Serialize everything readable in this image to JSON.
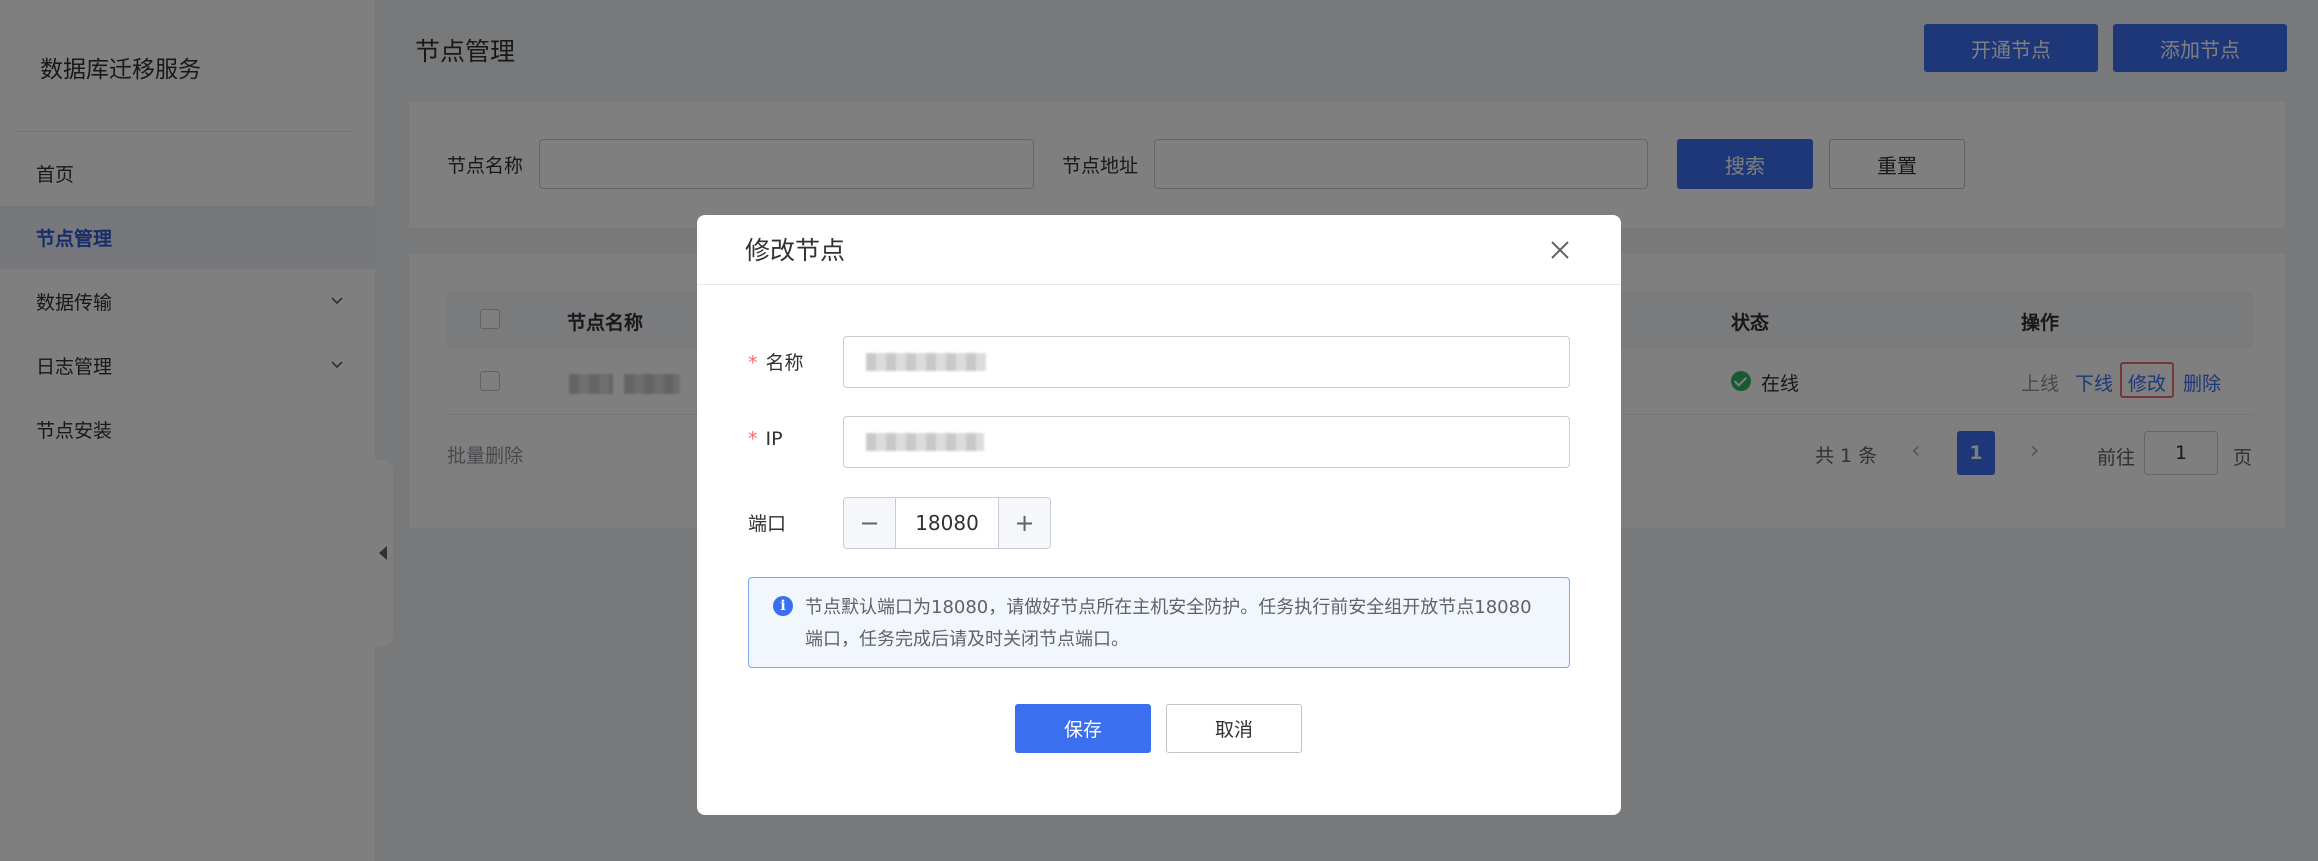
{
  "sidebar": {
    "brand": "数据库迁移服务",
    "items": [
      {
        "label": "首页"
      },
      {
        "label": "节点管理"
      },
      {
        "label": "数据传输"
      },
      {
        "label": "日志管理"
      },
      {
        "label": "节点安装"
      }
    ]
  },
  "header": {
    "title": "节点管理",
    "open_node_label": "开通节点",
    "add_node_label": "添加节点"
  },
  "filter": {
    "name_label": "节点名称",
    "address_label": "节点地址",
    "search_label": "搜索",
    "reset_label": "重置"
  },
  "table": {
    "columns": {
      "name": "节点名称",
      "status": "状态",
      "actions": "操作"
    },
    "rows": [
      {
        "status": "在线",
        "actions": [
          "上线",
          "下线",
          "修改",
          "删除"
        ]
      }
    ],
    "batch_delete_label": "批量删除"
  },
  "pagination": {
    "total_text": "共 1 条",
    "current_page": "1",
    "prev": "‹",
    "next": "›",
    "goto_label": "前往",
    "goto_value": "1",
    "page_suffix": "页"
  },
  "modal": {
    "title": "修改节点",
    "required_mark": "*",
    "name_label": "名称",
    "ip_label": "IP",
    "port_label": "端口",
    "port_value": "18080",
    "stepper_minus": "−",
    "stepper_plus": "+",
    "info_icon": "i",
    "info_text": "节点默认端口为18080，请做好节点所在主机安全防护。任务执行前安全组开放节点18080端口，任务完成后请及时关闭节点端口。",
    "save_label": "保存",
    "cancel_label": "取消"
  },
  "colors": {
    "primary": "#3a6ff0",
    "online": "#2fb46a",
    "required": "#f56c6c"
  }
}
